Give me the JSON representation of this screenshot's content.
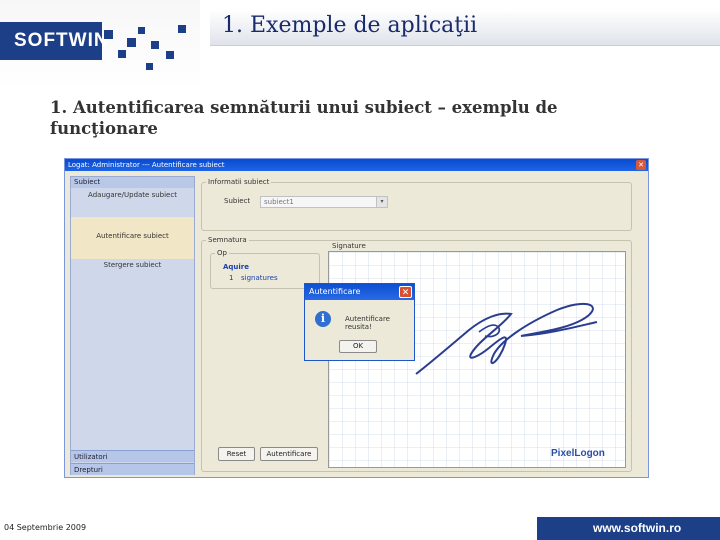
{
  "slide": {
    "logo_text": "SOFTWIN",
    "title": "1. Exemple de aplicaţii",
    "subtitle": "1. Autentificarea semnăturii unui subiect – exemplu de funcţionare",
    "footer_date": "04 Septembrie 2009",
    "footer_url": "www.softwin.ro"
  },
  "window": {
    "title": "Logat: Administrator --- Autentificare subiect",
    "sidebar": {
      "group_label": "Subiect",
      "items": [
        "Adaugare/Update subiect",
        "Autentificare subiect",
        "Stergere subiect"
      ],
      "selected_index": 1,
      "bottom_items": [
        "Utilizatori",
        "Drepturi"
      ]
    },
    "info_panel": {
      "title": "Informatii subiect",
      "field_label": "Subiect",
      "field_value": "subiect1"
    },
    "signature_panel": {
      "title": "Semnatura",
      "box_label": "Signature",
      "sub_label": "Op",
      "acquire_label": "Aquire",
      "count": "1",
      "count_label": "signatures"
    },
    "buttons": {
      "reset": "Reset",
      "authenticate": "Autentificare"
    },
    "brand_label": "PixelLogon"
  },
  "dialog": {
    "title": "Autentificare",
    "message": "Autentificare reusita!",
    "ok_label": "OK",
    "close_icon": "close-icon",
    "info_icon": "info-icon"
  },
  "colors": {
    "brand_blue": "#1c3f87",
    "title_blue": "#1a2a6c",
    "window_bg": "#ece9d8",
    "xp_title": "#0a4bcf"
  }
}
